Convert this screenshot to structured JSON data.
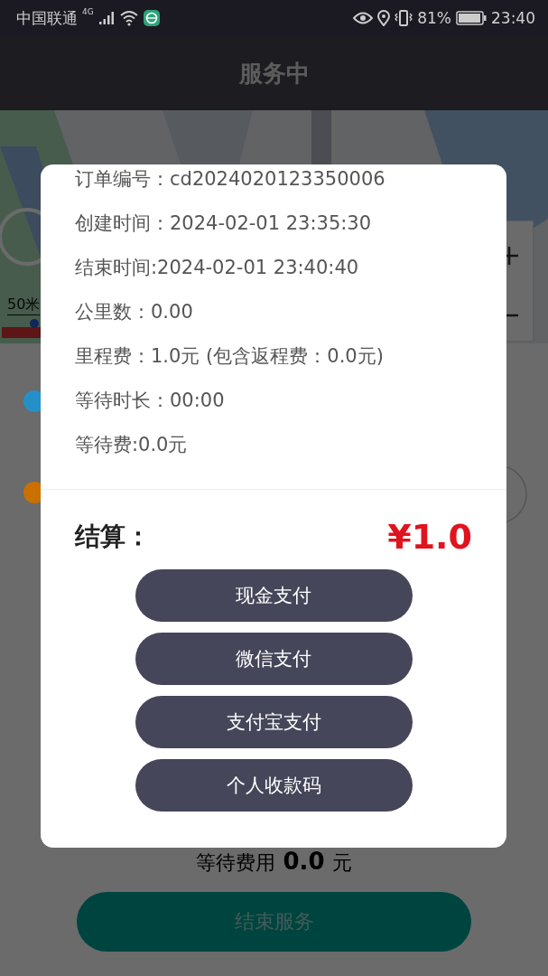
{
  "status_bar": {
    "carrier": "中国联通",
    "network": "4G",
    "battery": "81%",
    "time": "23:40"
  },
  "header": {
    "title": "服务中"
  },
  "map": {
    "scale": "50米"
  },
  "route": [
    {
      "color": "#2590c8"
    },
    {
      "color": "#c97000"
    }
  ],
  "wait_fee": {
    "label": "等待费用",
    "value": "0.0",
    "unit": "元"
  },
  "end_button": "结束服务",
  "dialog": {
    "rows": [
      "订单编号：cd2024020123350006",
      "创建时间：2024-02-01 23:35:30",
      "结束时间:2024-02-01 23:40:40",
      "公里数：0.00",
      "里程费：1.0元 (包含返程费：0.0元)",
      "等待时长：00:00",
      "等待费:0.0元"
    ],
    "settlement_label": "结算：",
    "amount": "¥1.0",
    "buttons": [
      "现金支付",
      "微信支付",
      "支付宝支付",
      "个人收款码"
    ]
  }
}
